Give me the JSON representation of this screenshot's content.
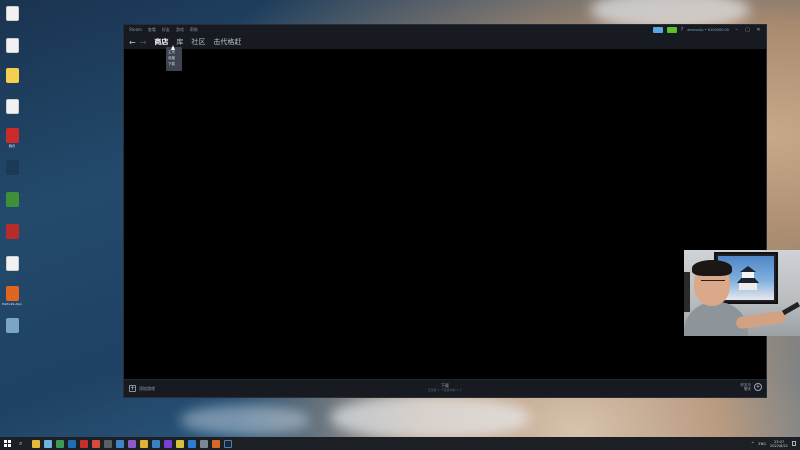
{
  "desktop_icons": [
    {
      "name": "file-icon-1",
      "style": "file",
      "caption": ""
    },
    {
      "name": "file-icon-2",
      "style": "file",
      "caption": ""
    },
    {
      "name": "folder-yellow-icon",
      "style": "yellow",
      "caption": ""
    },
    {
      "name": "file-icon-3",
      "style": "file",
      "caption": ""
    },
    {
      "name": "red-app-icon",
      "style": "red",
      "caption": "腾讯"
    },
    {
      "name": "app-icon-dark",
      "style": "dark",
      "caption": ""
    },
    {
      "name": "app-icon-green",
      "style": "green",
      "caption": ""
    },
    {
      "name": "red-file-icon",
      "style": "redfile",
      "caption": ""
    },
    {
      "name": "document-icon",
      "style": "file",
      "caption": ""
    },
    {
      "name": "half-life-icon",
      "style": "orange",
      "caption": "Half-Life Alyx"
    },
    {
      "name": "photo-icon",
      "style": "photo",
      "caption": ""
    }
  ],
  "steam": {
    "menu": [
      "Steam",
      "查看",
      "好友",
      "游戏",
      "帮助"
    ],
    "nav_tabs": [
      {
        "label": "商店",
        "active": true
      },
      {
        "label": "库",
        "active": false
      },
      {
        "label": "社区",
        "active": false
      },
      {
        "label": "击代格赶",
        "active": false
      }
    ],
    "dropdown": [
      "主页",
      "收藏",
      "下载"
    ],
    "account": "amuvulip • ¥100000.00",
    "help_glyph": "?",
    "footer": {
      "add_game": "添加游戏",
      "downloads_title": "下载",
      "downloads_sub": "已完成 1 个项目中的 1 个",
      "friends": "好友与\n聊天"
    }
  },
  "taskbar": {
    "ime": "ENG",
    "time": "23:07",
    "date": "2022/8/21"
  },
  "colors": {
    "steam_bg": "#171a21",
    "steam_text": "#b8c2cc",
    "accent_blue": "#57a8e0",
    "accent_green": "#5fbf2b"
  }
}
